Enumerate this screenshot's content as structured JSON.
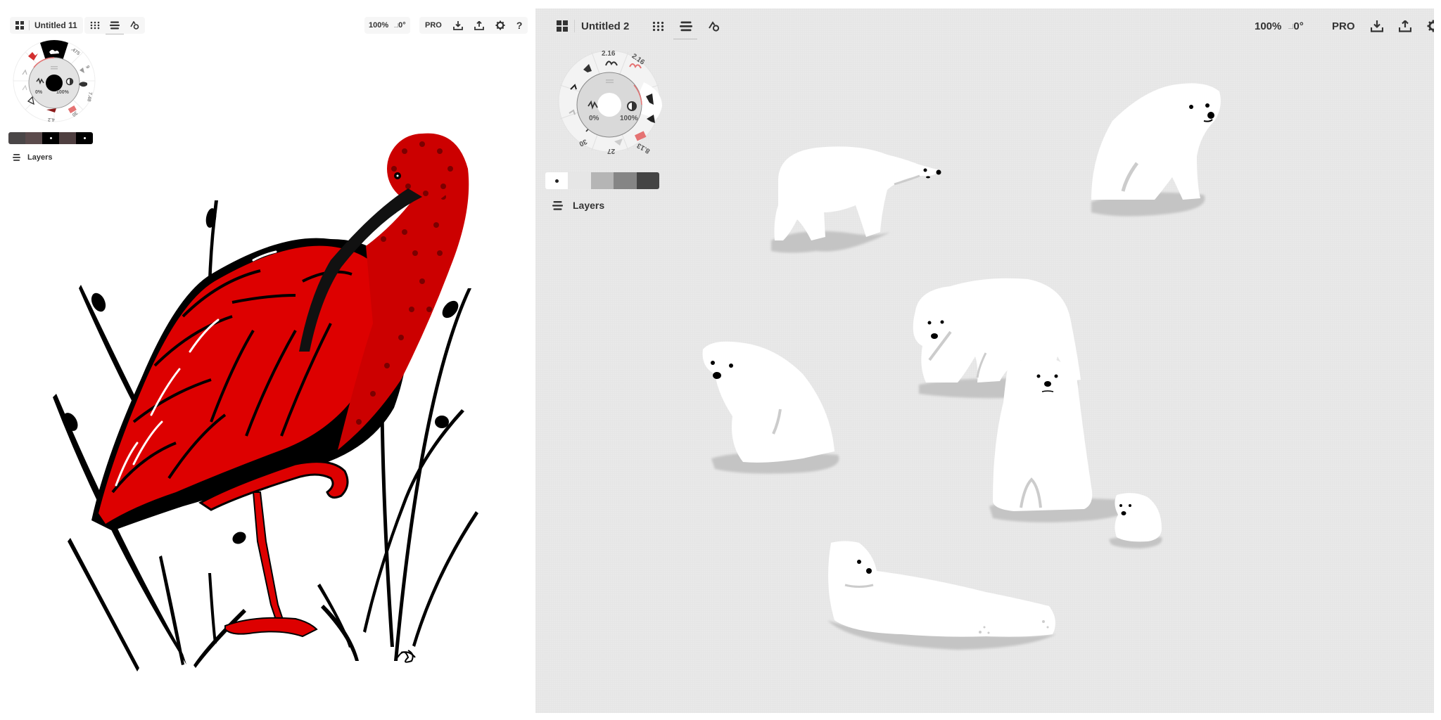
{
  "left_window": {
    "title": "Untitled 11",
    "toolbar": {
      "gallery_icon": "grid-2x2-icon",
      "grid_icon": "dot-grid-icon",
      "layers_toggle_icon": "stacked-lines-icon",
      "shapes_icon": "shapes-icon",
      "zoom": "100%",
      "rotation": "0°",
      "pro_label": "PRO",
      "import_icon": "download-tray-icon",
      "export_icon": "upload-tray-icon",
      "settings_icon": "gear-icon",
      "help_label": "?"
    },
    "brush_wheel": {
      "opacity": "0%",
      "size": "100%",
      "tool_values": [
        ".475",
        "9",
        "7.48",
        "30",
        "4.2"
      ],
      "active_color": "#000000",
      "accent_color": "#d32f2f"
    },
    "swatches": [
      {
        "color": "#4a4647",
        "selected": false
      },
      {
        "color": "#5b4b4c",
        "selected": false
      },
      {
        "color": "#000000",
        "selected": true
      },
      {
        "color": "#4f3f40",
        "selected": false
      },
      {
        "color": "#000000",
        "selected": true
      }
    ],
    "layers_label": "Layers",
    "artwork": {
      "subject": "scarlet ibis among grass",
      "primary_color": "#dd0000",
      "ink_color": "#000000"
    }
  },
  "right_window": {
    "title": "Untitled 2",
    "toolbar": {
      "gallery_icon": "grid-2x2-icon",
      "grid_icon": "dot-grid-icon",
      "layers_toggle_icon": "stacked-lines-icon",
      "shapes_icon": "shapes-icon",
      "zoom": "100%",
      "rotation": "0°",
      "pro_label": "PRO",
      "import_icon": "download-tray-icon",
      "export_icon": "upload-tray-icon",
      "settings_icon": "gear-icon"
    },
    "brush_wheel": {
      "opacity": "0%",
      "size": "100%",
      "tool_values": [
        "2.16",
        "2.16",
        "8.13",
        "27",
        "30"
      ],
      "active_color": "#ffffff",
      "accent_color": "#e57373"
    },
    "swatches": [
      {
        "color": "#ffffff",
        "selected": true
      },
      {
        "color": "#e6e6e6",
        "selected": false
      },
      {
        "color": "#b5b5b5",
        "selected": false
      },
      {
        "color": "#858585",
        "selected": false
      },
      {
        "color": "#444444",
        "selected": false
      }
    ],
    "layers_label": "Layers",
    "artwork": {
      "subject": "polar bears",
      "bear_count": 7,
      "bear_color": "#ffffff",
      "shadow_color": "#c4c4c4",
      "background_color": "#e9e9e9"
    }
  }
}
